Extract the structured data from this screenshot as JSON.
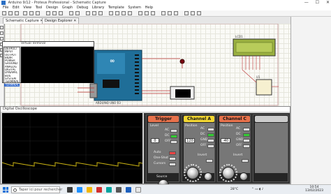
{
  "window": {
    "title": "Arduino 9/12 - Proteus Professional - Schematic Capture",
    "buttons": [
      "—",
      "☐",
      "✕"
    ]
  },
  "menu": [
    "File",
    "Edit",
    "View",
    "Tool",
    "Design",
    "Graph",
    "Debug",
    "Library",
    "Template",
    "System",
    "Help"
  ],
  "tabs": [
    "Schematic Capture",
    "Design Explorer"
  ],
  "schematic": {
    "lcd_label": "LCD1",
    "arduino_label": "ARDUINO UNO R3",
    "uln_label": "U1"
  },
  "virtual_terminal": {
    "title": "Virtual Terminal",
    "list": [
      "DEFAULT",
      "INPUT",
      "OUTPUT",
      "BIDIR",
      "POWER",
      "GROUND",
      "ANALOG",
      "DIGITAL",
      "DYNAMIC",
      "BUS",
      "SYSTEM",
      "TERMINAL",
      "TERMINAL"
    ],
    "selected_index": 12
  },
  "oscilloscope": {
    "title": "Digital Oscilloscope",
    "trigger": {
      "header": "Trigger",
      "level_label": "Level",
      "level_value": "0",
      "modes": [
        "AC",
        "DC",
        "OFF"
      ],
      "buttons": [
        "Auto",
        "One-Shot",
        "Cursors"
      ],
      "source_label": "Source",
      "color": "#e8724c"
    },
    "channel_a": {
      "header": "Channel A",
      "position_label": "Position",
      "position_value": "120",
      "modes": [
        "AC",
        "DC",
        "GND",
        "OFF"
      ],
      "invert_label": "Invert",
      "color": "#f2d633"
    },
    "channel_c": {
      "header": "Channel C",
      "position_label": "Position",
      "position_value": "-40",
      "modes": [
        "AC",
        "DC",
        "GND",
        "OFF"
      ],
      "invert_label": "Invert",
      "color": "#e8724c"
    },
    "trace_color": "#c9b212"
  },
  "taskbar": {
    "search_placeholder": "Taper ici pour rechercher",
    "weather": "28°C",
    "time": "10:54",
    "date": "13/02/2023"
  }
}
